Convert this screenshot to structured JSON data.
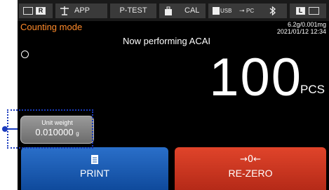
{
  "topbar": {
    "badge_r": "R",
    "app_label": "APP",
    "ptest_label": "P-TEST",
    "cal_label": "CAL",
    "usb_label": "USB",
    "pc_label": "PC",
    "badge_l": "L"
  },
  "mode_label": "Counting mode",
  "status_text": "Now performing ACAI",
  "readability": "6.2g/0.001mg",
  "datetime": "2021/01/12  12:34",
  "display": {
    "value": "100",
    "unit": "PCS"
  },
  "unit_weight": {
    "label": "Unit weight",
    "value": "0.010000",
    "unit": "g"
  },
  "buttons": {
    "print_label": "PRINT",
    "rezero_icon": "→0←",
    "rezero_label": "RE-ZERO"
  },
  "colors": {
    "mode_label": "#ff8a2a",
    "print_button": "#1a5db5",
    "rezero_button": "#cc3520",
    "callout": "#1a3bbd"
  },
  "icons": [
    "battery-icon",
    "balance-icon",
    "weight-icon",
    "usb-icon",
    "pc-icon",
    "bluetooth-icon",
    "document-icon"
  ]
}
